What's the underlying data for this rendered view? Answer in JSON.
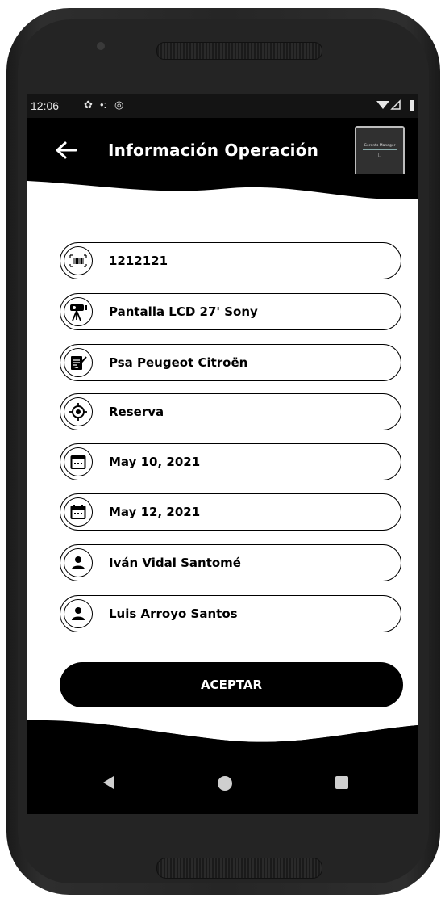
{
  "status_bar": {
    "time": "12:06",
    "icons": [
      "settings-icon",
      "signal-dots-icon",
      "sync-icon",
      "wifi-icon",
      "cell-signal-icon",
      "battery-icon"
    ]
  },
  "app_bar": {
    "title": "Información Operación",
    "back_icon": "arrow-left-icon",
    "logo_text": "Gerents Manager",
    "logo_sub": "[]"
  },
  "fields": [
    {
      "icon": "barcode-icon",
      "value": "1212121"
    },
    {
      "icon": "projector-icon",
      "value": "Pantalla LCD 27' Sony"
    },
    {
      "icon": "signed-document-icon",
      "value": "Psa Peugeot Citroën"
    },
    {
      "icon": "target-icon",
      "value": "Reserva"
    },
    {
      "icon": "calendar-icon",
      "value": "May 10, 2021"
    },
    {
      "icon": "calendar-icon",
      "value": "May 12, 2021"
    },
    {
      "icon": "person-icon",
      "value": "Iván Vidal Santomé"
    },
    {
      "icon": "person-icon",
      "value": "Luis Arroyo Santos"
    }
  ],
  "accept_button": {
    "label": "ACEPTAR"
  },
  "colors": {
    "primary": "#000000",
    "background": "#ffffff",
    "status_bar": "#141414"
  }
}
